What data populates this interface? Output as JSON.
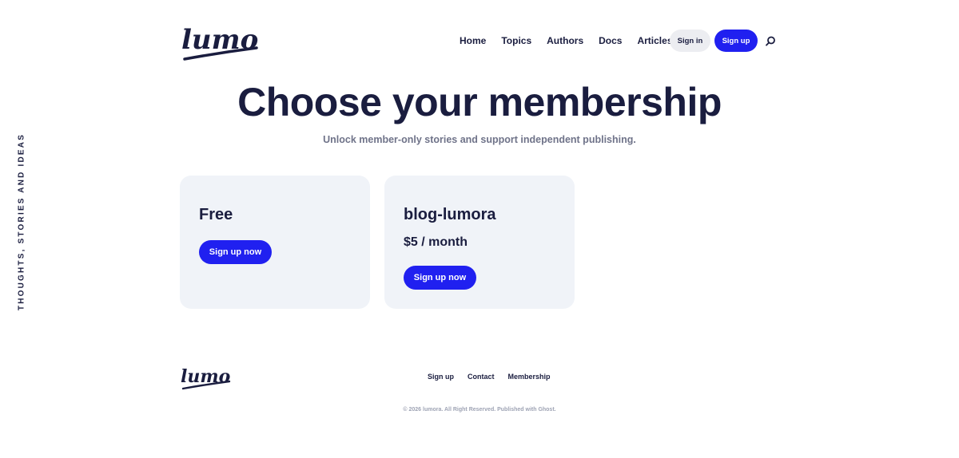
{
  "side_text": "THOUGHTS, STORIES AND IDEAS",
  "brand": {
    "name": "lumora",
    "color": "#1a1d3f",
    "accent": "#2020f0"
  },
  "header": {
    "nav": [
      "Home",
      "Topics",
      "Authors",
      "Docs",
      "Articles"
    ],
    "signin_label": "Sign in",
    "signup_label": "Sign up",
    "search_icon": "search-icon"
  },
  "hero": {
    "title": "Choose your membership",
    "subtitle": "Unlock member-only stories and support independent publishing."
  },
  "plans": [
    {
      "name": "Free",
      "price": "",
      "button_label": "Sign up now"
    },
    {
      "name": "blog-lumora",
      "price": "$5 / month",
      "button_label": "Sign up now"
    }
  ],
  "footer": {
    "links": [
      "Sign up",
      "Contact",
      "Membership"
    ],
    "copyright": "© 2026 lumora. All Right Reserved. Published with Ghost."
  }
}
